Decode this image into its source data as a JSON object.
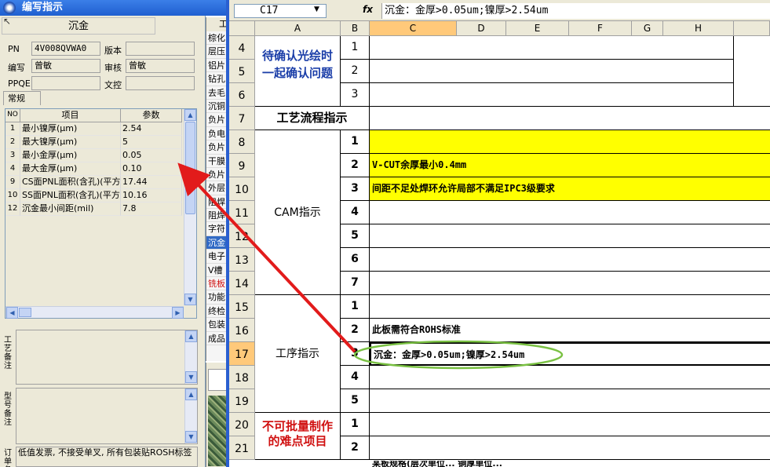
{
  "dialog": {
    "title": "编写指示",
    "header": "沉金",
    "fields": {
      "pn_label": "PN",
      "pn_value": "4V008QVWA0",
      "version_label": "版本",
      "version_value": "",
      "writer_label": "编写",
      "writer_value": "曾敏",
      "review_label": "审核",
      "review_value": "曾敏",
      "ppqe_label": "PPQE",
      "ppqe_value": "",
      "doc_label": "文控",
      "doc_value": ""
    },
    "tab": "常规",
    "grid": {
      "headers": [
        "NO",
        "项目",
        "参数"
      ],
      "rows": [
        {
          "no": "1",
          "item": "最小镍厚(μm)",
          "param": "2.54"
        },
        {
          "no": "2",
          "item": "最大镍厚(μm)",
          "param": "5"
        },
        {
          "no": "3",
          "item": "最小金厚(μm)",
          "param": "0.05"
        },
        {
          "no": "4",
          "item": "最大金厚(μm)",
          "param": "0.10"
        },
        {
          "no": "9",
          "item": "CS面PNL面积(含孔)(平方",
          "param": "17.44"
        },
        {
          "no": "10",
          "item": "SS面PNL面积(含孔)(平方",
          "param": "10.16"
        },
        {
          "no": "12",
          "item": "沉金最小间距(mil)",
          "param": "7.8"
        }
      ]
    },
    "memo1_label": "工艺备注",
    "memo2_label": "型号备注",
    "memo3_label": "订单备注",
    "memo3_text": "低值发票, 不接受单叉, 所有包装贴ROSH标签"
  },
  "strip": {
    "header": "工",
    "items": [
      "棕化",
      "层压",
      "铝片",
      "钻孔",
      "去毛",
      "沉铜",
      "负片",
      "负电",
      "负片",
      "干膜",
      "负片",
      "外层",
      "阻焊",
      "阻焊",
      "字符",
      "沉金",
      "电子",
      "V槽",
      "铣板",
      "功能",
      "终检",
      "包装",
      "成品"
    ],
    "selected_index": 15,
    "red_index": 18
  },
  "excel": {
    "namebox": "C17",
    "fx": "fx",
    "formula": "沉金：金厚>0.05um;镍厚>2.54um",
    "columns": [
      "A",
      "B",
      "C",
      "D",
      "E",
      "F",
      "G",
      "H"
    ],
    "rows": [
      "4",
      "5",
      "6",
      "7",
      "8",
      "9",
      "10",
      "11",
      "12",
      "13",
      "14",
      "15",
      "16",
      "17",
      "18",
      "19",
      "20",
      "21"
    ],
    "section1": "待确认光绘时一起确认问题",
    "section1_b": [
      "1",
      "2",
      "3"
    ],
    "section2": "工艺流程指示",
    "section3": "CAM指示",
    "section3_b": [
      "1",
      "2",
      "3",
      "4",
      "5",
      "6",
      "7"
    ],
    "section3_c": [
      "",
      "V-CUT余厚最小0.4mm",
      "间距不足处焊环允许局部不满足IPC3级要求",
      "",
      "",
      "",
      ""
    ],
    "section4": "工序指示",
    "section4_b": [
      "1",
      "2",
      "3",
      "4",
      "5"
    ],
    "section4_c": [
      "",
      "此板需符合ROHS标准",
      "沉金：金厚>0.05um;镍厚>2.54um",
      "",
      ""
    ],
    "section5": "不可批量制作的难点项目",
    "section5_b": [
      "1",
      "2"
    ],
    "bottom_partial": "某板规格(层次单位... 铜厚单位..."
  },
  "colors": {
    "highlight_yellow": "#ffff00",
    "arrow_red": "#e21b1b",
    "ellipse_green": "#7ac143",
    "section_blue": "#1b3ea8",
    "section_red": "#d01010"
  }
}
